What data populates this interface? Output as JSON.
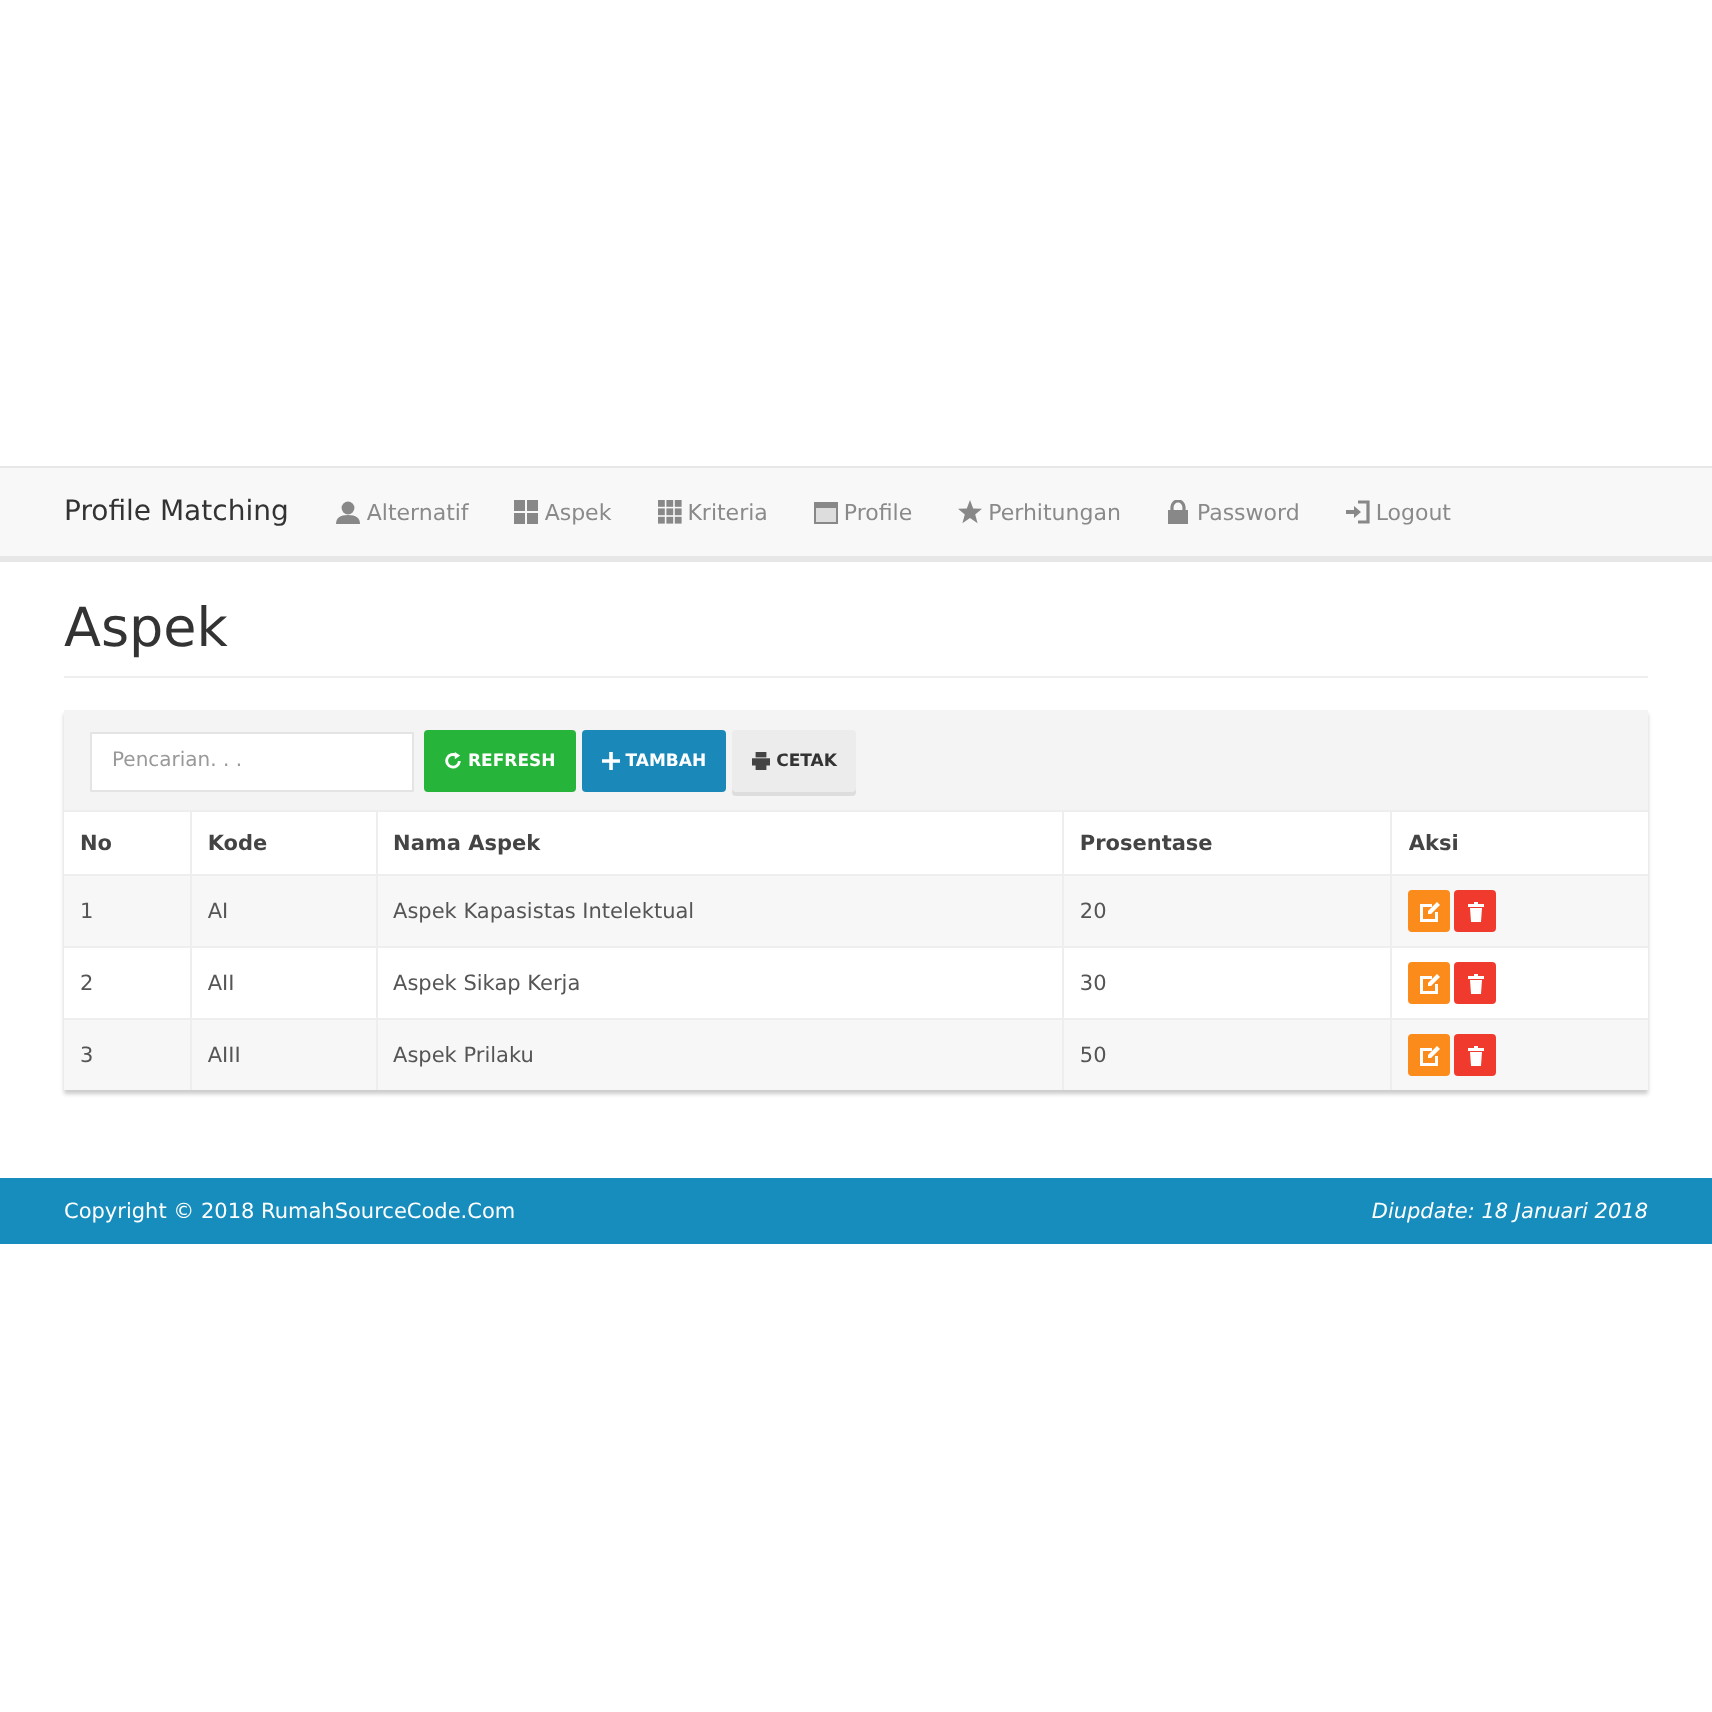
{
  "navbar": {
    "brand": "Profile Matching",
    "items": [
      {
        "label": "Alternatif"
      },
      {
        "label": "Aspek"
      },
      {
        "label": "Kriteria"
      },
      {
        "label": "Profile"
      },
      {
        "label": "Perhitungan"
      },
      {
        "label": "Password"
      },
      {
        "label": "Logout"
      }
    ]
  },
  "page_title": "Aspek",
  "toolbar": {
    "search": {
      "placeholder": "Pencarian. . ."
    },
    "buttons": [
      {
        "kind": "refresh",
        "label": "REFRESH"
      },
      {
        "kind": "add",
        "label": "TAMBAH"
      },
      {
        "kind": "print",
        "label": "CETAK"
      }
    ]
  },
  "table": {
    "columns": [
      "No",
      "Kode",
      "Nama Aspek",
      "Prosentase",
      "Aksi"
    ],
    "rows": [
      {
        "no": "1",
        "kode": "AI",
        "nama": "Aspek Kapasistas Intelektual",
        "prosentase": "20"
      },
      {
        "no": "2",
        "kode": "AII",
        "nama": "Aspek Sikap Kerja",
        "prosentase": "30"
      },
      {
        "no": "3",
        "kode": "AIII",
        "nama": "Aspek Prilaku",
        "prosentase": "50"
      }
    ]
  },
  "footer": {
    "copyright": "Copyright © 2018 RumahSourceCode.Com",
    "updated": "Diupdate: 18 Januari 2018"
  }
}
